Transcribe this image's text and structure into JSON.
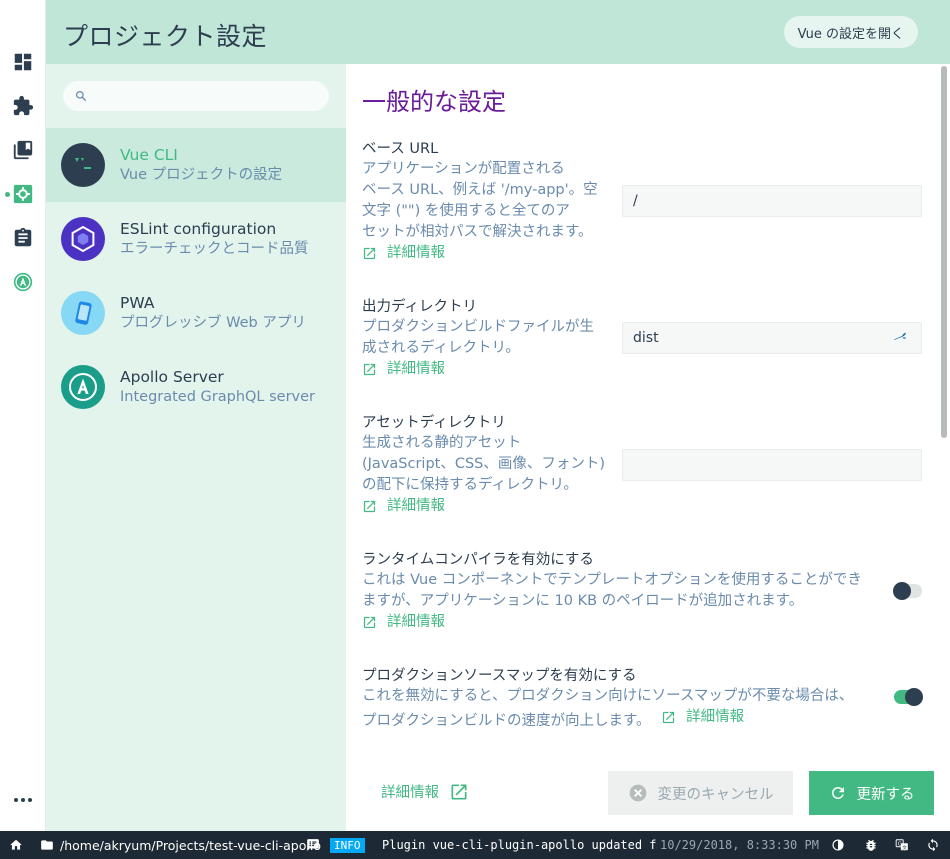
{
  "header": {
    "title": "プロジェクト設定",
    "open_vue_label": "Vue の設定を開く"
  },
  "rail": {
    "icons": [
      "dashboard-icon",
      "plugins-icon",
      "dependencies-icon",
      "configuration-icon",
      "tasks-icon",
      "apollo-icon"
    ],
    "active": "configuration-icon"
  },
  "sidebar": {
    "search_placeholder": "",
    "items": [
      {
        "name": "Vue CLI",
        "desc": "Vue プロジェクトの設定",
        "selected": true
      },
      {
        "name": "ESLint configuration",
        "desc": "エラーチェックとコード品質",
        "selected": false
      },
      {
        "name": "PWA",
        "desc": "プログレッシブ Web アプリ",
        "selected": false
      },
      {
        "name": "Apollo Server",
        "desc": "Integrated GraphQL server",
        "selected": false
      }
    ]
  },
  "content": {
    "section_title": "一般的な設定",
    "more_info": "詳細情報",
    "prompts": [
      {
        "label": "ベース URL",
        "desc_lines": [
          "アプリケーションが配置される",
          "ベース URL、例えば '/my-app'。空",
          "文字 (\"\") を使用すると全てのア",
          "セットが相対パスで解決されます。"
        ],
        "value": "/"
      },
      {
        "label": "出力ディレクトリ",
        "desc_lines": [
          "プロダクションビルドファイルが生",
          "成されるディレクトリ。"
        ],
        "value": "dist"
      },
      {
        "label": "アセットディレクトリ",
        "desc_lines": [
          "生成される静的アセット",
          "(JavaScript、CSS、画像、フォント)",
          "の配下に保持するディレクトリ。"
        ],
        "value": ""
      },
      {
        "label": "ランタイムコンパイラを有効にする",
        "desc_lines": [
          "これは Vue コンポーネントでテンプレートオプションを使用することができ",
          "ますが、アプリケーションに 10 KB のペイロードが追加されます。"
        ],
        "enabled": false
      },
      {
        "label": "プロダクションソースマップを有効にする",
        "desc_lines": [
          "これを無効にすると、プロダクション向けにソースマップが不要な場合は、",
          "プロダクションビルドの速度が向上します。"
        ],
        "enabled": true
      }
    ]
  },
  "footer": {
    "more_info": "詳細情報",
    "cancel_label": "変更のキャンセル",
    "update_label": "更新する"
  },
  "statusbar": {
    "path": "/home/akryum/Projects/test-vue-cli-apollo",
    "log_level": "INFO",
    "log_message": "Plugin vue-cli-plugin-apollo updated f…",
    "timestamp": "10/29/2018, 8:33:30 PM"
  },
  "colors": {
    "accent": "#42b983",
    "dark": "#2c3e50",
    "header_bg": "#bfe6d6",
    "sidebar_bg": "#e3f4ec",
    "section_title": "#6a1b9a",
    "statusbar_bg": "#1d2935",
    "info_badge": "#03a9f4"
  }
}
